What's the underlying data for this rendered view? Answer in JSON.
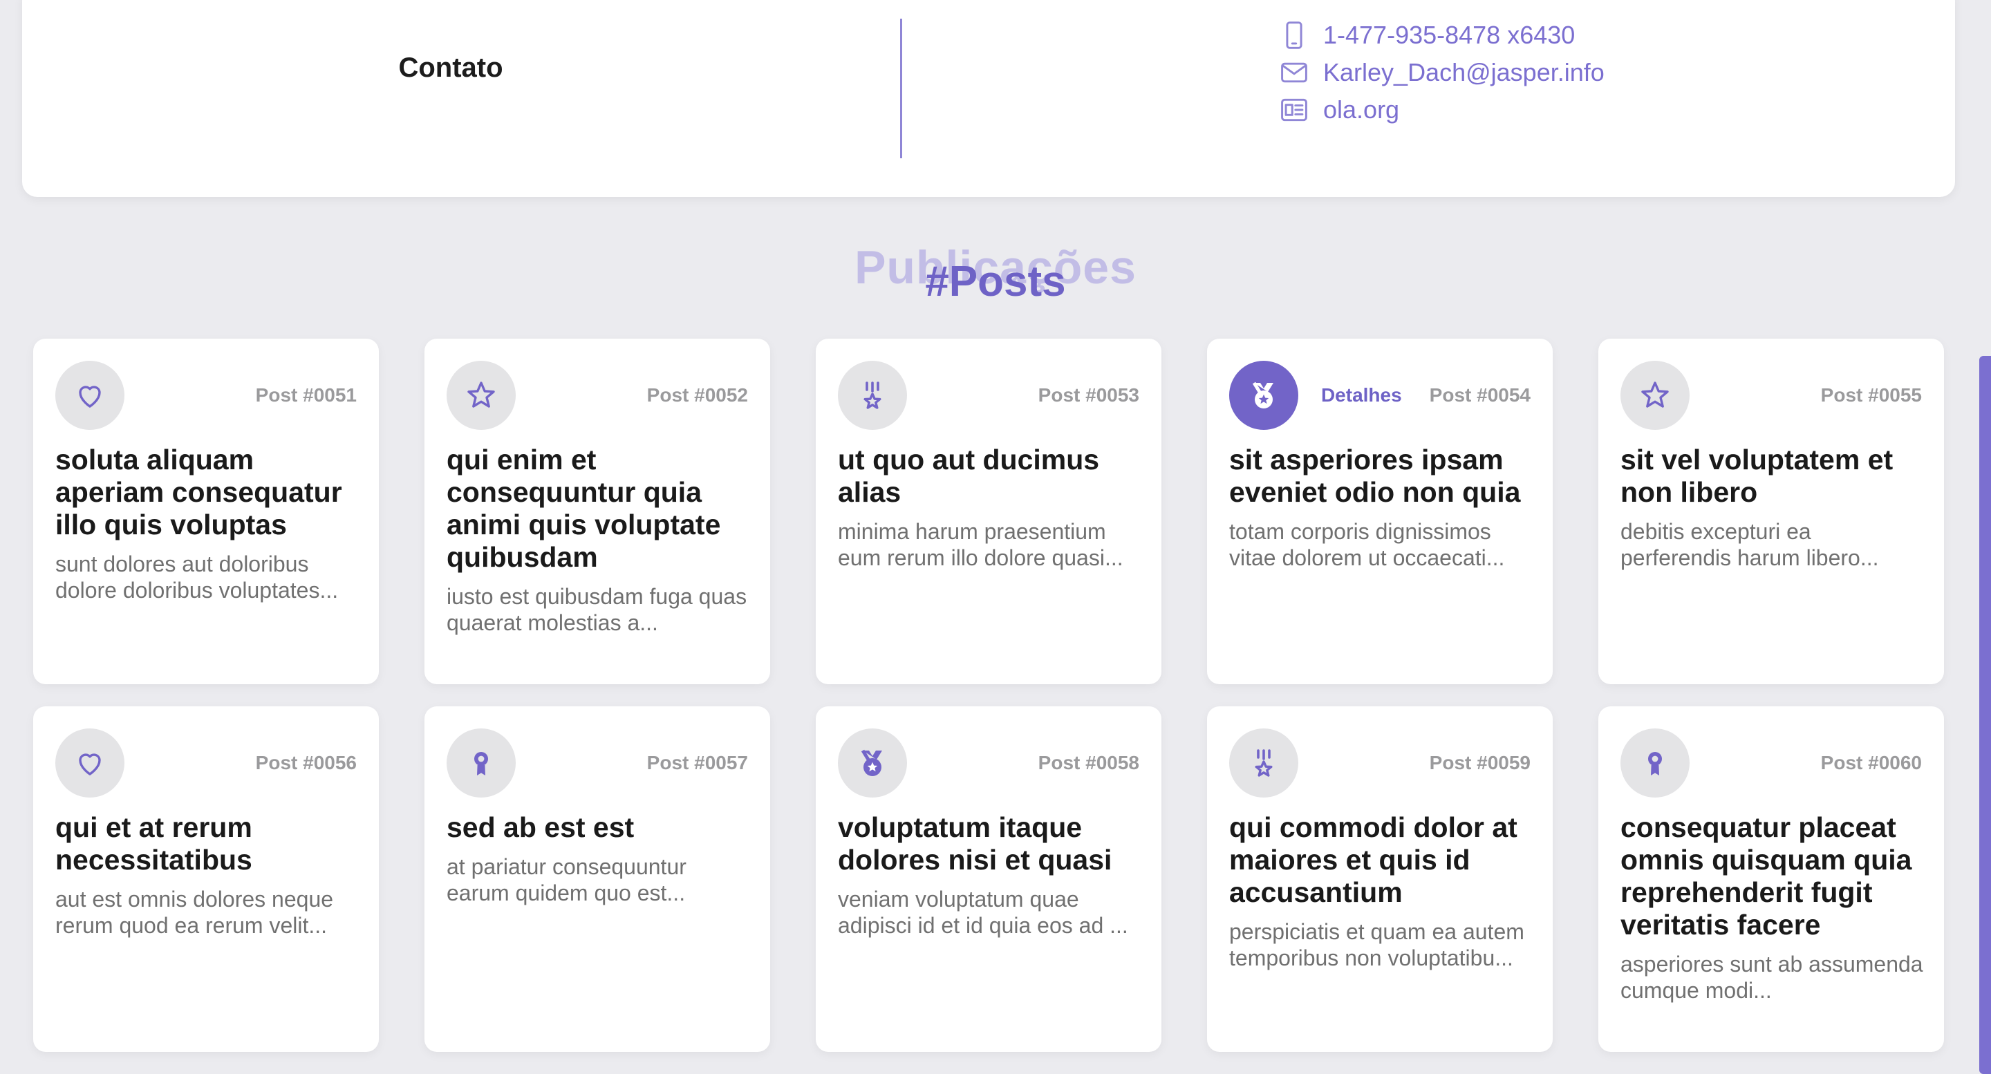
{
  "contact": {
    "title": "Contato",
    "phone": "1-477-935-8478 x6430",
    "email": "Karley_Dach@jasper.info",
    "website": "ola.org",
    "phone_icon": "phone-icon",
    "email_icon": "mail-icon",
    "website_icon": "website-icon"
  },
  "section": {
    "heading_back": "Publicações",
    "heading_front": "#Posts"
  },
  "details_label": "Detalhes",
  "colors": {
    "accent": "#7264c8",
    "accent_text": "#6e62c6",
    "background": "#ebebef",
    "card": "#ffffff",
    "badge_bg": "#e4e4e6"
  },
  "posts": [
    {
      "number": "Post #0051",
      "icon": "heart-icon",
      "title": "soluta aliquam aperiam consequatur illo quis voluptas",
      "excerpt": "sunt dolores aut doloribus dolore doloribus voluptates..."
    },
    {
      "number": "Post #0052",
      "icon": "star-icon",
      "title": "qui enim et consequuntur quia animi quis voluptate quibusdam",
      "excerpt": "iusto est quibusdam fuga quas quaerat molestias a..."
    },
    {
      "number": "Post #0053",
      "icon": "military-medal-icon",
      "title": "ut quo aut ducimus alias",
      "excerpt": "minima harum praesentium eum rerum illo dolore quasi..."
    },
    {
      "number": "Post #0054",
      "icon": "medal-icon",
      "title": "sit asperiores ipsam eveniet odio non quia",
      "excerpt": "totam corporis dignissimos vitae dolorem ut occaecati...",
      "active": true
    },
    {
      "number": "Post #0055",
      "icon": "star-icon",
      "title": "sit vel voluptatem et non libero",
      "excerpt": "debitis excepturi ea perferendis harum libero..."
    },
    {
      "number": "Post #0056",
      "icon": "heart-icon",
      "title": "qui et at rerum necessitatibus",
      "excerpt": "aut est omnis dolores neque rerum quod ea rerum velit..."
    },
    {
      "number": "Post #0057",
      "icon": "award-ribbon-icon",
      "title": "sed ab est est",
      "excerpt": "at pariatur consequuntur earum quidem quo est..."
    },
    {
      "number": "Post #0058",
      "icon": "medal-icon",
      "title": "voluptatum itaque dolores nisi et quasi",
      "excerpt": "veniam voluptatum quae adipisci id et id quia eos ad ..."
    },
    {
      "number": "Post #0059",
      "icon": "military-medal-icon",
      "title": "qui commodi dolor at maiores et quis id accusantium",
      "excerpt": "perspiciatis et quam ea autem temporibus non voluptatibu..."
    },
    {
      "number": "Post #0060",
      "icon": "award-ribbon-icon",
      "title": "consequatur placeat omnis quisquam quia reprehenderit fugit veritatis facere",
      "excerpt": "asperiores sunt ab assumenda cumque modi..."
    }
  ]
}
